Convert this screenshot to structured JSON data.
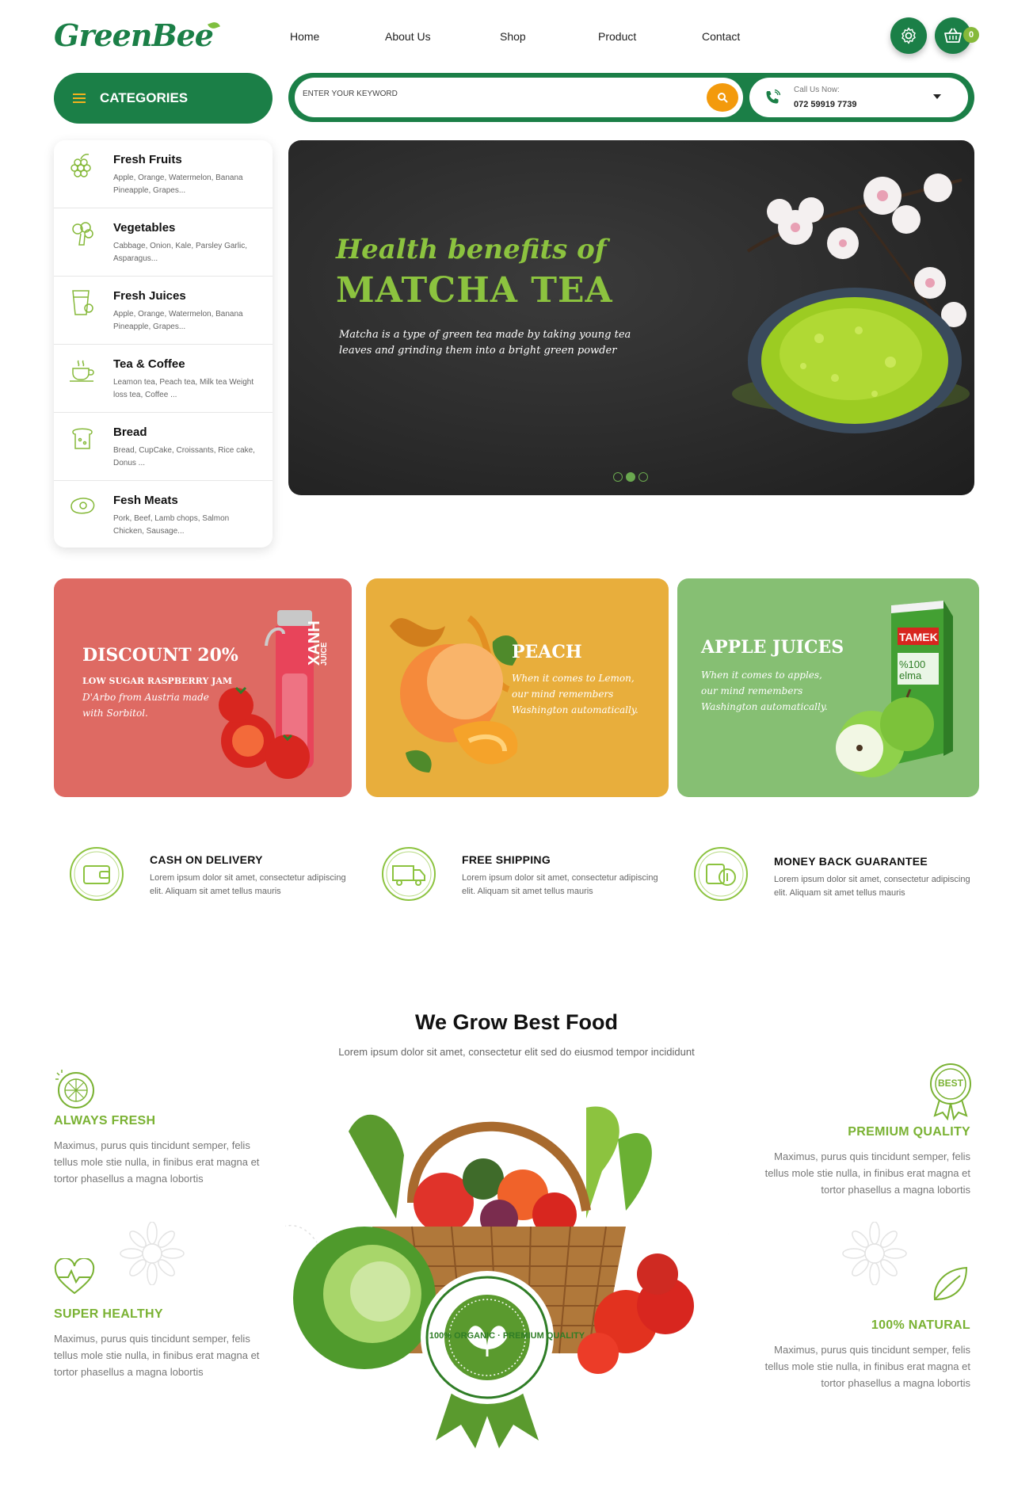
{
  "brand": {
    "name": "GreenBee"
  },
  "nav": {
    "items": [
      "Home",
      "About Us",
      "Shop",
      "Product",
      "Contact"
    ]
  },
  "header": {
    "cart_count": "0"
  },
  "categories": {
    "button_label": "CATEGORIES",
    "items": [
      {
        "name": "Fresh Fruits",
        "desc": "Apple, Orange, Watermelon, Banana Pineapple, Grapes..."
      },
      {
        "name": "Vegetables",
        "desc": "Cabbage, Onion, Kale, Parsley Garlic, Asparagus..."
      },
      {
        "name": "Fresh Juices",
        "desc": "Apple, Orange, Watermelon, Banana Pineapple, Grapes..."
      },
      {
        "name": "Tea & Coffee",
        "desc": "Leamon tea, Peach tea, Milk tea Weight loss tea, Coffee ..."
      },
      {
        "name": "Bread",
        "desc": "Bread, CupCake, Croissants, Rice cake, Donus ..."
      },
      {
        "name": "Fesh Meats",
        "desc": "Pork, Beef, Lamb chops, Salmon Chicken, Sausage..."
      }
    ]
  },
  "search": {
    "placeholder": "ENTER YOUR KEYWORD"
  },
  "contact": {
    "label": "Call Us Now:",
    "phone": "072 59919 7739"
  },
  "hero": {
    "title_line1": "Health benefits of",
    "title_line2": "MATCHA TEA",
    "description": "Matcha is a type of green tea made by taking young tea leaves and grinding them into a bright green powder",
    "slides": 3,
    "active_slide": 2
  },
  "banners": [
    {
      "title": "DISCOUNT 20%",
      "subtitle": "LOW SUGAR RASPBERRY JAM",
      "text": "D'Arbo from Austria made with Sorbitol.",
      "bottle_label": "XANH",
      "bottle_sub": "JUICE"
    },
    {
      "title": "PEACH",
      "text": "When it comes to Lemon, our mind remembers Washington automatically."
    },
    {
      "title": "APPLE JUICES",
      "text": "When it comes to apples, our mind remembers Washington automatically.",
      "pack_brand": "TAMEK",
      "pack_text": "%100 elma"
    }
  ],
  "features": [
    {
      "title": "CASH ON DELIVERY",
      "desc": "Lorem ipsum dolor sit amet, consectetur adipiscing elit. Aliquam sit amet tellus mauris"
    },
    {
      "title": "FREE SHIPPING",
      "desc": "Lorem ipsum dolor sit amet, consectetur adipiscing elit. Aliquam sit amet tellus mauris"
    },
    {
      "title": "MONEY BACK GUARANTEE",
      "desc": "Lorem ipsum dolor sit amet, consectetur adipiscing elit. Aliquam sit amet tellus mauris"
    }
  ],
  "grow": {
    "title": "We Grow Best Food",
    "subtitle": "Lorem ipsum dolor sit amet, consectetur elit sed do eiusmod tempor incididunt",
    "left": [
      {
        "title": "ALWAYS FRESH",
        "desc": "Maximus, purus quis tincidunt semper, felis tellus mole stie nulla, in finibus erat magna et tortor phasellus a magna lobortis"
      },
      {
        "title": "SUPER HEALTHY",
        "desc": "Maximus, purus quis tincidunt semper, felis tellus mole stie nulla, in finibus erat magna et tortor phasellus a magna lobortis"
      }
    ],
    "right": [
      {
        "title": "PREMIUM QUALITY",
        "desc": "Maximus, purus quis tincidunt semper, felis tellus mole stie nulla, in finibus erat magna et tortor phasellus a magna lobortis"
      },
      {
        "title": "100% NATURAL",
        "desc": "Maximus, purus quis tincidunt semper, felis tellus mole stie nulla, in finibus erat magna et tortor phasellus a magna lobortis"
      }
    ],
    "badge_text": "100% ORGANIC · PREMIUM QUALITY",
    "best_badge": "BEST"
  },
  "colors": {
    "primary": "#1b7f47",
    "accent": "#8cc33f",
    "orange": "#f39a0c",
    "banner_red": "#de6a63",
    "banner_yellow": "#e8ae3c",
    "banner_green": "#86bf73"
  }
}
